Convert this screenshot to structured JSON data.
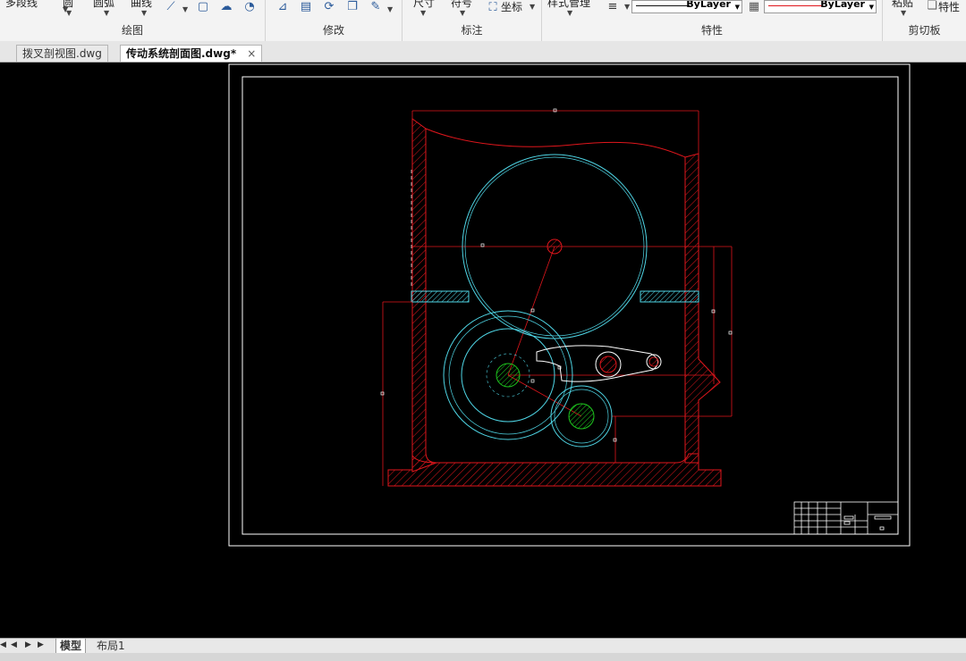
{
  "ribbon": {
    "groups": [
      {
        "title": "绘图",
        "partial_labels": [
          "多段线",
          "圆",
          "圆弧",
          "曲线"
        ]
      },
      {
        "title": "修改"
      },
      {
        "title": "标注",
        "partial_labels": [
          "尺寸",
          "符号",
          "坐标"
        ]
      },
      {
        "title": "特性",
        "partial_labels": [
          "样式管理"
        ],
        "linetype": "ByLayer",
        "color": "ByLayer"
      },
      {
        "title": "剪切板",
        "partial_labels": [
          "粘贴",
          "特性"
        ]
      }
    ]
  },
  "tabs": [
    {
      "label": "拨叉剖视图.dwg",
      "active": false
    },
    {
      "label": "传动系统剖面图.dwg*",
      "active": true
    }
  ],
  "close_icon": "×",
  "layout_tabs": [
    {
      "label": "模型",
      "active": true
    },
    {
      "label": "布局1",
      "active": false
    }
  ],
  "nav_arrows": [
    "◀",
    "◀",
    "▶",
    "▶"
  ],
  "colors": {
    "canvas_bg": "#000000",
    "outline": "#e0161c",
    "gear": "#4fd6e6",
    "frame": "#ffffff",
    "hatch_green": "#1ec81e"
  }
}
